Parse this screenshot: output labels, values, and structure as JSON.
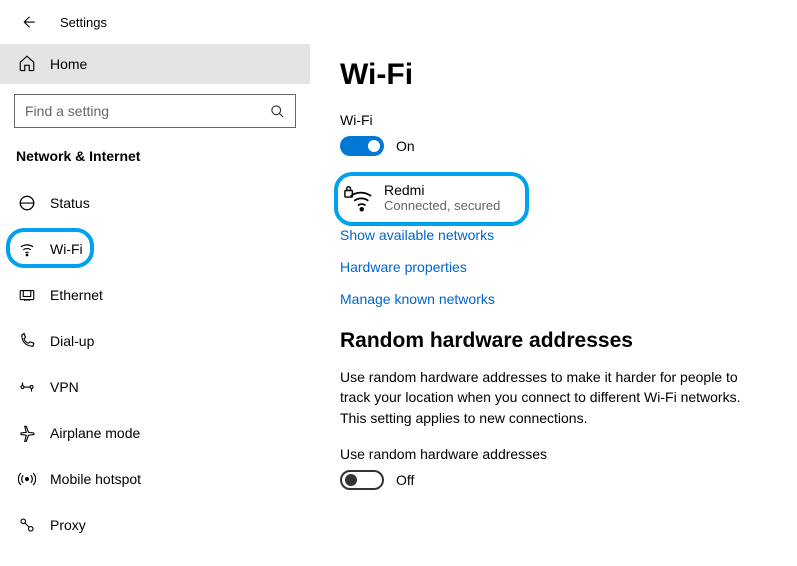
{
  "window": {
    "title": "Settings"
  },
  "sidebar": {
    "home_label": "Home",
    "search_placeholder": "Find a setting",
    "group_header": "Network & Internet",
    "items": [
      {
        "label": "Status"
      },
      {
        "label": "Wi-Fi"
      },
      {
        "label": "Ethernet"
      },
      {
        "label": "Dial-up"
      },
      {
        "label": "VPN"
      },
      {
        "label": "Airplane mode"
      },
      {
        "label": "Mobile hotspot"
      },
      {
        "label": "Proxy"
      }
    ]
  },
  "main": {
    "title": "Wi-Fi",
    "wifi_section_label": "Wi-Fi",
    "wifi_toggle": {
      "state_label": "On"
    },
    "connected_network": {
      "name": "Redmi",
      "status": "Connected, secured"
    },
    "links": {
      "show_available": "Show available networks",
      "hardware_props": "Hardware properties",
      "manage_known": "Manage known networks"
    },
    "random_section": {
      "heading": "Random hardware addresses",
      "body": "Use random hardware addresses to make it harder for people to track your location when you connect to different Wi-Fi networks. This setting applies to new connections.",
      "toggle_label": "Use random hardware addresses",
      "toggle_state": "Off"
    }
  }
}
